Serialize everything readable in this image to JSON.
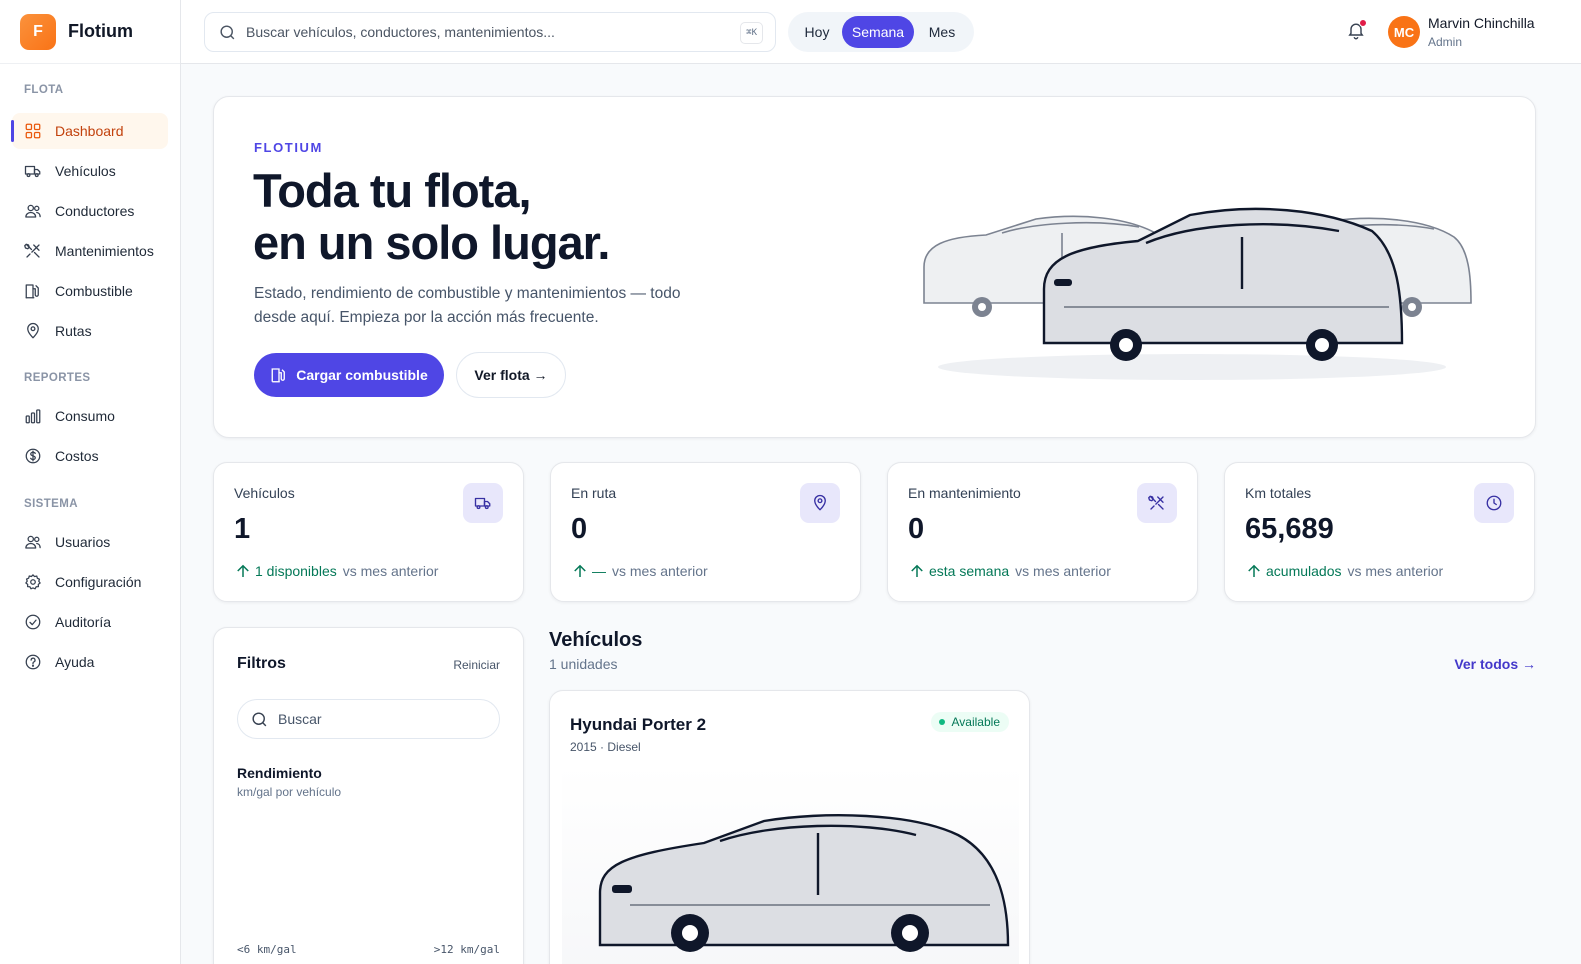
{
  "brand": {
    "initial": "F",
    "name": "Flotium"
  },
  "colors": {
    "accent": "#4f46e5",
    "brand": "#f97316",
    "positive": "#047857",
    "alert": "#e11d48"
  },
  "sidebar": {
    "sections": [
      {
        "title": "FLOTA",
        "items": [
          {
            "label": "Dashboard",
            "icon": "grid-icon",
            "active": true
          },
          {
            "label": "Vehículos",
            "icon": "truck-icon"
          },
          {
            "label": "Conductores",
            "icon": "users-icon"
          },
          {
            "label": "Mantenimientos",
            "icon": "tools-icon"
          },
          {
            "label": "Combustible",
            "icon": "fuel-icon"
          },
          {
            "label": "Rutas",
            "icon": "map-pin-icon"
          }
        ]
      },
      {
        "title": "REPORTES",
        "items": [
          {
            "label": "Consumo",
            "icon": "bar-chart-icon"
          },
          {
            "label": "Costos",
            "icon": "dollar-icon"
          }
        ]
      },
      {
        "title": "SISTEMA",
        "items": [
          {
            "label": "Usuarios",
            "icon": "users-icon"
          },
          {
            "label": "Configuración",
            "icon": "gear-icon"
          },
          {
            "label": "Auditoría",
            "icon": "check-circle-icon"
          },
          {
            "label": "Ayuda",
            "icon": "help-icon"
          }
        ]
      }
    ]
  },
  "topbar": {
    "search_placeholder": "Buscar vehículos, conductores, mantenimientos...",
    "shortcut": "⌘K",
    "range": {
      "options": [
        "Hoy",
        "Semana",
        "Mes"
      ],
      "selected": "Semana"
    },
    "user": {
      "initials": "MC",
      "name": "Marvin Chinchilla",
      "role": "Admin"
    }
  },
  "hero": {
    "eyebrow": "FLOTIUM",
    "title_line1": "Toda tu flota,",
    "title_line2": "en un solo lugar.",
    "description": "Estado, rendimiento de combustible y mantenimientos — todo desde aquí. Empieza por la acción más frecuente.",
    "primary_cta": "Cargar combustible",
    "secondary_cta": "Ver flota →"
  },
  "stats": [
    {
      "title": "Vehículos",
      "value": "1",
      "delta": "1 disponibles",
      "comparison": "vs mes anterior",
      "icon": "truck-icon"
    },
    {
      "title": "En ruta",
      "value": "0",
      "delta": "—",
      "comparison": "vs mes anterior",
      "icon": "map-pin-icon"
    },
    {
      "title": "En mantenimiento",
      "value": "0",
      "delta": "esta semana",
      "comparison": "vs mes anterior",
      "icon": "tools-icon"
    },
    {
      "title": "Km totales",
      "value": "65,689",
      "delta": "acumulados",
      "comparison": "vs mes anterior",
      "icon": "clock-icon"
    }
  ],
  "filters": {
    "title": "Filtros",
    "reset": "Reiniciar",
    "search_placeholder": "Buscar",
    "performance_title": "Rendimiento",
    "performance_subtitle": "km/gal por vehículo",
    "range_min": "<6 km/gal",
    "range_max": ">12 km/gal"
  },
  "vehicles": {
    "title": "Vehículos",
    "count": "1 unidades",
    "view_all": "Ver todos →",
    "items": [
      {
        "name": "Hyundai Porter 2",
        "meta": "2015 · Diesel",
        "status": "Available"
      }
    ]
  }
}
